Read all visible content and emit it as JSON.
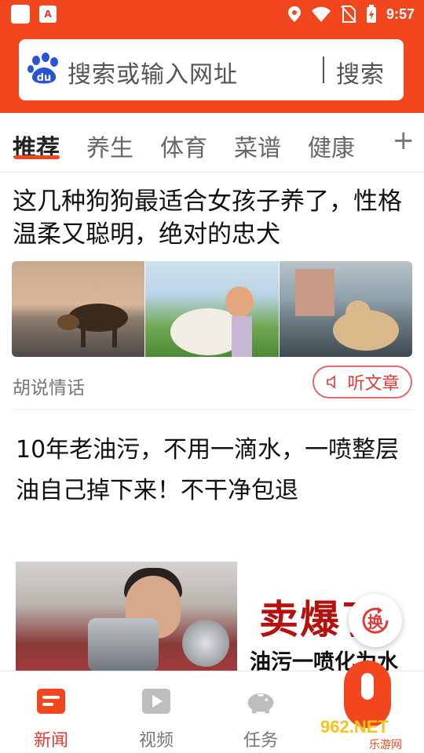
{
  "status_bar": {
    "time": "9:57",
    "app_badge": "A",
    "icons": [
      "location-icon",
      "wifi-icon",
      "no-sim-icon",
      "battery-charging-icon"
    ]
  },
  "search": {
    "placeholder": "搜索或输入网址",
    "button_label": "搜索",
    "logo": "du"
  },
  "tabs": {
    "items": [
      {
        "label": "推荐",
        "active": true
      },
      {
        "label": "养生",
        "active": false
      },
      {
        "label": "体育",
        "active": false
      },
      {
        "label": "菜谱",
        "active": false
      },
      {
        "label": "健康",
        "active": false
      }
    ],
    "more_icon": "+"
  },
  "feed": {
    "article1": {
      "title": "这几种狗狗最适合女孩子养了，性格温柔又聪明，绝对的忠犬",
      "source": "胡说情话",
      "listen_label": "听文章"
    },
    "article2": {
      "title": "10年老油污，不用一滴水，一喷整层油自己掉下来！不干净包退",
      "ad_headline": "卖爆了",
      "ad_sub": "油污一喷化为水"
    },
    "refresh_label": "换"
  },
  "bottom_nav": {
    "items": [
      {
        "label": "新闻",
        "active": true
      },
      {
        "label": "视频",
        "active": false
      },
      {
        "label": "任务",
        "active": false
      }
    ]
  },
  "watermark": {
    "brand": "962.NET",
    "sub": "乐游网"
  },
  "colors": {
    "brand_red": "#f2461f",
    "accent_red": "#e53935",
    "baidu_blue": "#2a52d6"
  }
}
